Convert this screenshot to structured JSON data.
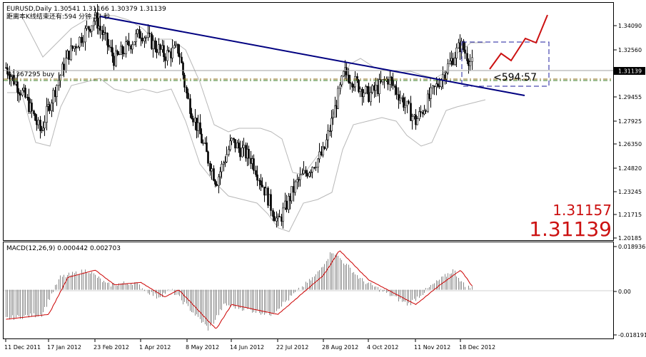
{
  "header": {
    "symbol_line": "EURUSD,Daily  1.30541 1.31166 1.30379 1.31139",
    "countdown_line": "距离本K线结束还有:594 分钟 57 秒"
  },
  "annotations": {
    "order_label": "#1367295 buy",
    "countdown_box": "<594:57"
  },
  "price_display": {
    "bid": "1.31157",
    "last": "1.31139"
  },
  "main_panel": {
    "y_ticks": [
      "1.34090",
      "1.32560",
      "1.31139",
      "1.29455",
      "1.27925",
      "1.26350",
      "1.24820",
      "1.23245",
      "1.21715",
      "1.20185"
    ],
    "current_price_tag": "1.31139"
  },
  "macd_panel": {
    "title": "MACD(12,26,9) 0.000442 0.002703",
    "y_ticks": [
      "0.018936",
      "0.00",
      "-0.018191"
    ]
  },
  "x_axis": {
    "dates": [
      "11 Dec 2011",
      "17 Jan 2012",
      "23 Feb 2012",
      "1 Apr 2012",
      "8 May 2012",
      "14 Jun 2012",
      "22 Jul 2012",
      "28 Aug 2012",
      "4 Oct 2012",
      "11 Nov 2012",
      "18 Dec 2012"
    ]
  },
  "colors": {
    "trendline": "#000080",
    "forecast": "#cc1111",
    "box": "#1c1c9c",
    "macd_signal": "#cc0000",
    "macd_hist": "#8a8a8a",
    "envelope": "#b8b8b8",
    "candles": "#000000",
    "order_line": "#8a6a10",
    "price_line": "#9a9a9a"
  },
  "chart_data": {
    "type": "candlestick",
    "symbol": "EURUSD",
    "timeframe": "Daily",
    "ohlc_last": {
      "open": 1.30541,
      "high": 1.31166,
      "low": 1.30379,
      "close": 1.31139
    },
    "x_dates": [
      "11 Dec 2011",
      "17 Jan 2012",
      "23 Feb 2012",
      "1 Apr 2012",
      "8 May 2012",
      "14 Jun 2012",
      "22 Jul 2012",
      "28 Aug 2012",
      "4 Oct 2012",
      "11 Nov 2012",
      "18 Dec 2012"
    ],
    "price_range": [
      1.198,
      1.352
    ],
    "close_path": [
      {
        "date": "11 Dec 2011",
        "close": 1.31
      },
      {
        "date": "28 Dec 2011",
        "close": 1.29
      },
      {
        "date": "10 Jan 2012",
        "close": 1.268
      },
      {
        "date": "17 Jan 2012",
        "close": 1.285
      },
      {
        "date": "1 Feb 2012",
        "close": 1.318
      },
      {
        "date": "23 Feb 2012",
        "close": 1.342
      },
      {
        "date": "10 Mar 2012",
        "close": 1.315
      },
      {
        "date": "1 Apr 2012",
        "close": 1.333
      },
      {
        "date": "20 Apr 2012",
        "close": 1.318
      },
      {
        "date": "1 May 2012",
        "close": 1.322
      },
      {
        "date": "8 May 2012",
        "close": 1.29
      },
      {
        "date": "1 Jun 2012",
        "close": 1.236
      },
      {
        "date": "14 Jun 2012",
        "close": 1.262
      },
      {
        "date": "1 Jul 2012",
        "close": 1.25
      },
      {
        "date": "22 Jul 2012",
        "close": 1.209
      },
      {
        "date": "6 Aug 2012",
        "close": 1.235
      },
      {
        "date": "28 Aug 2012",
        "close": 1.255
      },
      {
        "date": "14 Sep 2012",
        "close": 1.307
      },
      {
        "date": "4 Oct 2012",
        "close": 1.292
      },
      {
        "date": "20 Oct 2012",
        "close": 1.303
      },
      {
        "date": "11 Nov 2012",
        "close": 1.275
      },
      {
        "date": "1 Dec 2012",
        "close": 1.302
      },
      {
        "date": "18 Dec 2012",
        "close": 1.325
      },
      {
        "date": "28 Dec 2012",
        "close": 1.311
      }
    ],
    "trendline": {
      "start": {
        "date": "23 Feb 2012",
        "price": 1.343
      },
      "end": {
        "date": "early Jan 2013",
        "price": 1.296
      }
    },
    "forecast_path": [
      1.312,
      1.318,
      1.314,
      1.326,
      1.322,
      1.346
    ],
    "order_level": 1.3072,
    "current_price": 1.31139,
    "macd": {
      "name": "MACD(12,26,9)",
      "main": 0.000442,
      "signal": 0.002703,
      "range": [
        -0.018191,
        0.018936
      ],
      "signal_path": [
        {
          "date": "11 Dec 2011",
          "value": -0.012
        },
        {
          "date": "17 Jan 2012",
          "value": -0.01
        },
        {
          "date": "1 Feb 2012",
          "value": 0.005
        },
        {
          "date": "23 Feb 2012",
          "value": 0.008
        },
        {
          "date": "10 Mar 2012",
          "value": 0.002
        },
        {
          "date": "1 Apr 2012",
          "value": 0.003
        },
        {
          "date": "20 Apr 2012",
          "value": -0.003
        },
        {
          "date": "1 May 2012",
          "value": 0.0
        },
        {
          "date": "1 Jun 2012",
          "value": -0.016
        },
        {
          "date": "14 Jun 2012",
          "value": -0.006
        },
        {
          "date": "22 Jul 2012",
          "value": -0.01
        },
        {
          "date": "28 Aug 2012",
          "value": 0.006
        },
        {
          "date": "10 Sep 2012",
          "value": 0.016
        },
        {
          "date": "4 Oct 2012",
          "value": 0.004
        },
        {
          "date": "11 Nov 2012",
          "value": -0.006
        },
        {
          "date": "1 Dec 2012",
          "value": 0.002
        },
        {
          "date": "18 Dec 2012",
          "value": 0.008
        },
        {
          "date": "28 Dec 2012",
          "value": 0.001
        }
      ]
    }
  }
}
